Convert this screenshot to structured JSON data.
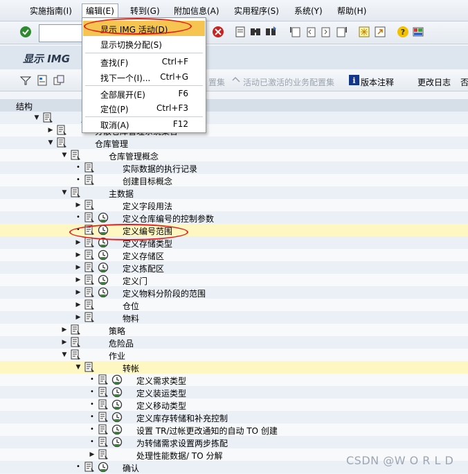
{
  "menubar": {
    "items": [
      "实施指南(I)",
      "编辑(E)",
      "转到(G)",
      "附加信息(A)",
      "实用程序(S)",
      "系统(Y)",
      "帮助(H)"
    ]
  },
  "toolbar": {
    "command_field_value": ""
  },
  "title": "显示 IMG",
  "app_toolbar": {
    "hidden_text": "置集",
    "activated_bc_sets": "活动已激活的业务配置集",
    "release_notes": "版本注释",
    "change_log": "更改日志",
    "truncated": "否"
  },
  "column_header": "结构",
  "edit_menu": {
    "items": [
      {
        "label": "显示 IMG 活动(D)",
        "key": ""
      },
      {
        "label": "显示切换分配(S)",
        "key": ""
      },
      {
        "label": "查找(F)",
        "key": "Ctrl+F"
      },
      {
        "label": "找下一个(I)...",
        "key": "Ctrl+G"
      },
      {
        "label": "全部展开(E)",
        "key": "F6"
      },
      {
        "label": "定位(P)",
        "key": "Ctrl+F3"
      },
      {
        "label": "取消(A)",
        "key": "F12"
      }
    ]
  },
  "tree": {
    "rows": [
      {
        "label": "启",
        "indent": 0,
        "twisty": "open",
        "clock": false
      },
      {
        "label": "分散仓库管理系统集合",
        "indent": 1,
        "twisty": "closed",
        "clock": false
      },
      {
        "label": "仓库管理",
        "indent": 1,
        "twisty": "open",
        "clock": false
      },
      {
        "label": "仓库管理概念",
        "indent": 2,
        "twisty": "open",
        "clock": false
      },
      {
        "label": "实际数据的执行记录",
        "indent": 3,
        "twisty": "leaf",
        "clock": false
      },
      {
        "label": "创建目标概念",
        "indent": 3,
        "twisty": "leaf",
        "clock": false
      },
      {
        "label": "主数据",
        "indent": 2,
        "twisty": "open",
        "clock": false
      },
      {
        "label": "定义字段用法",
        "indent": 3,
        "twisty": "closed",
        "clock": false
      },
      {
        "label": "定义仓库编号的控制参数",
        "indent": 3,
        "twisty": "leaf",
        "clock": true
      },
      {
        "label": "定义编号范围",
        "indent": 3,
        "twisty": "leaf",
        "clock": true
      },
      {
        "label": "定义存储类型",
        "indent": 3,
        "twisty": "closed",
        "clock": true
      },
      {
        "label": "定义存储区",
        "indent": 3,
        "twisty": "closed",
        "clock": true
      },
      {
        "label": "定义拣配区",
        "indent": 3,
        "twisty": "closed",
        "clock": true
      },
      {
        "label": "定义门",
        "indent": 3,
        "twisty": "closed",
        "clock": true
      },
      {
        "label": "定义物料分阶段的范围",
        "indent": 3,
        "twisty": "closed",
        "clock": true
      },
      {
        "label": "仓位",
        "indent": 3,
        "twisty": "closed",
        "clock": false
      },
      {
        "label": "物料",
        "indent": 3,
        "twisty": "closed",
        "clock": false
      },
      {
        "label": "策略",
        "indent": 2,
        "twisty": "closed",
        "clock": false
      },
      {
        "label": "危险品",
        "indent": 2,
        "twisty": "closed",
        "clock": false
      },
      {
        "label": "作业",
        "indent": 2,
        "twisty": "open",
        "clock": false
      },
      {
        "label": "转帐",
        "indent": 3,
        "twisty": "open",
        "clock": false
      },
      {
        "label": "定义需求类型",
        "indent": 4,
        "twisty": "leaf",
        "clock": true
      },
      {
        "label": "定义装运类型",
        "indent": 4,
        "twisty": "leaf",
        "clock": true
      },
      {
        "label": "定义移动类型",
        "indent": 4,
        "twisty": "leaf",
        "clock": true
      },
      {
        "label": "定义库存转储和补充控制",
        "indent": 4,
        "twisty": "leaf",
        "clock": true
      },
      {
        "label": "设置 TR/过帐更改通知的自动 TO 创建",
        "indent": 4,
        "twisty": "leaf",
        "clock": true
      },
      {
        "label": "为转储需求设置两步拣配",
        "indent": 4,
        "twisty": "leaf",
        "clock": true
      },
      {
        "label": "处理性能数据/ TO 分解",
        "indent": 4,
        "twisty": "closed",
        "clock": false
      },
      {
        "label": "确认",
        "indent": 3,
        "twisty": "leaf",
        "clock": true
      }
    ]
  },
  "watermark": "CSDN @W O R L D",
  "colors": {
    "highlight_row": "#fff7c2",
    "menu_selection": "#f5c451",
    "annotation_ellipse": "#e3201b"
  }
}
